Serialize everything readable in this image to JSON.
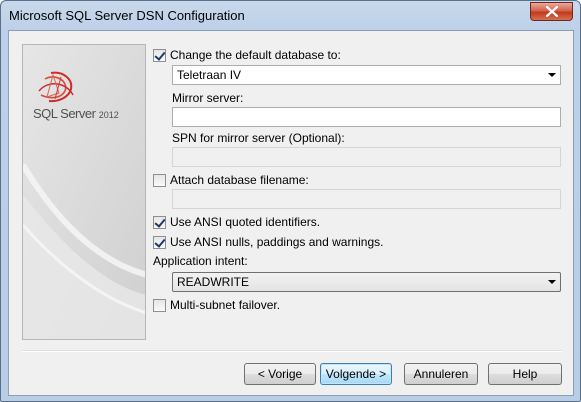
{
  "window": {
    "title": "Microsoft SQL Server DSN Configuration",
    "close_icon": "close-icon"
  },
  "branding": {
    "logo_icon": "sql-server-logo-icon",
    "product_name_sql": "SQL Server",
    "product_year": "2012"
  },
  "form": {
    "change_default_db": {
      "label": "Change the default database to:",
      "checked": true
    },
    "default_db_value": "Teletraan IV",
    "mirror_server": {
      "label": "Mirror server:",
      "value": ""
    },
    "spn_mirror": {
      "label": "SPN for mirror server (Optional):",
      "value": "",
      "enabled": false
    },
    "attach_db": {
      "label": "Attach database filename:",
      "checked": false
    },
    "attach_db_value": "",
    "ansi_quoted": {
      "label": "Use ANSI quoted identifiers.",
      "checked": true
    },
    "ansi_nulls": {
      "label": "Use ANSI nulls, paddings and warnings.",
      "checked": true
    },
    "app_intent": {
      "label": "Application intent:",
      "value": "READWRITE"
    },
    "multi_subnet": {
      "label": "Multi-subnet failover.",
      "checked": false
    }
  },
  "buttons": {
    "back": "< Vorige",
    "next": "Volgende >",
    "cancel": "Annuleren",
    "help": "Help"
  },
  "colors": {
    "title_bar": "#bcd0e8",
    "dialog_bg": "#f0f0f0",
    "default_button": "#bee6fd",
    "close_button": "#c0391f",
    "logo_red": "#cf2b2b"
  }
}
